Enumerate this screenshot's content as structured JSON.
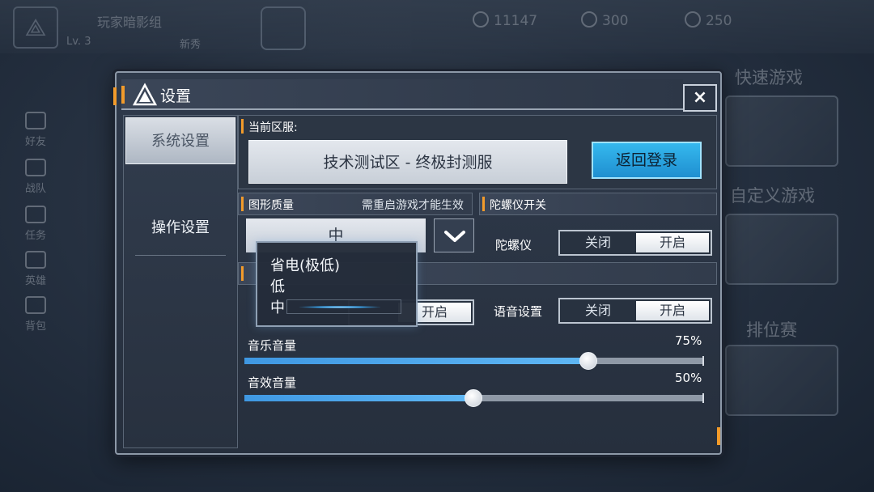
{
  "background": {
    "player_name": "玩家暗影组",
    "level": "Lv. 3",
    "player_tag": "新秀",
    "currencies": [
      "11147",
      "300",
      "250"
    ],
    "left_menu": [
      "好友",
      "战队",
      "任务",
      "英雄",
      "背包"
    ],
    "right_modes": [
      "快速游戏",
      "自定义游戏",
      "排位赛"
    ]
  },
  "dialog": {
    "title": "设置",
    "close_label": "×"
  },
  "nav": {
    "items": [
      {
        "label": "系统设置",
        "active": true
      },
      {
        "label": "操作设置",
        "active": false
      }
    ]
  },
  "server": {
    "heading": "当前区服:",
    "value": "技术测试区 - 终极封测服",
    "back_button": "返回登录"
  },
  "graphics": {
    "heading": "图形质量",
    "note": "需重启游戏才能生效",
    "selected": "中",
    "options": [
      "省电(极低)",
      "低",
      "中"
    ]
  },
  "gyro": {
    "heading": "陀螺仪开关",
    "label": "陀螺仪",
    "off_label": "关闭",
    "on_label": "开启",
    "value": "开启"
  },
  "audio": {
    "hidden_toggle_on_label": "开启",
    "voice_label": "语音设置",
    "voice_off": "关闭",
    "voice_on": "开启",
    "voice_value": "开启",
    "music_label": "音乐音量",
    "music_value": 0.75,
    "music_pct": "75%",
    "sfx_label": "音效音量",
    "sfx_value": 0.5,
    "sfx_pct": "50%"
  },
  "colors": {
    "accent_orange": "#f29b2b",
    "button_blue": "#1f8fd0",
    "slider_fill": "#4aa6ec"
  }
}
